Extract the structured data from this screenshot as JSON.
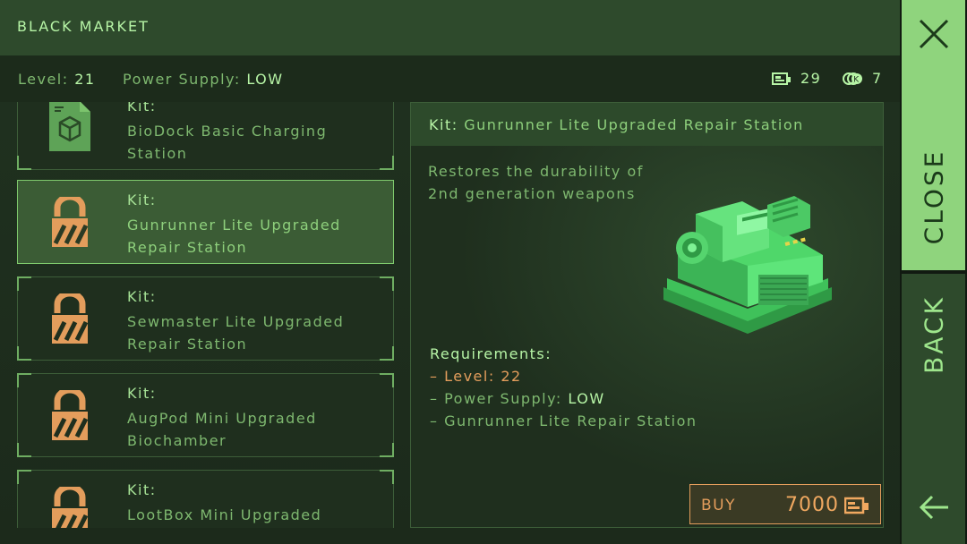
{
  "header": {
    "title": "BLACK MARKET"
  },
  "status": {
    "level_label": "Level:",
    "level_value": "21",
    "power_label": "Power Supply:",
    "power_value": "LOW",
    "caps": "29",
    "tokens": "7"
  },
  "list": {
    "items": [
      {
        "kit_label": "Kit:",
        "name": "BioDock Basic Charging Station",
        "icon": "kit-schematic-icon",
        "locked": false
      },
      {
        "kit_label": "Kit:",
        "name": "Gunrunner Lite Upgraded Repair Station",
        "icon": "lock-icon",
        "locked": true,
        "selected": true
      },
      {
        "kit_label": "Kit:",
        "name": "Sewmaster Lite Upgraded Repair Station",
        "icon": "lock-icon",
        "locked": true
      },
      {
        "kit_label": "Kit:",
        "name": "AugPod Mini Upgraded Biochamber",
        "icon": "lock-icon",
        "locked": true
      },
      {
        "kit_label": "Kit:",
        "name": "LootBox Mini Upgraded",
        "icon": "lock-icon",
        "locked": true
      }
    ]
  },
  "detail": {
    "kit_label": "Kit:",
    "title": "Gunrunner Lite Upgraded Repair Station",
    "description": "Restores the durability of 2nd generation weapons",
    "requirements_heading": "Requirements:",
    "req_level_label": "– Level:",
    "req_level_value": "22",
    "req_power_label": "– Power Supply:",
    "req_power_value": "LOW",
    "req_item": "– Gunrunner Lite Repair Station"
  },
  "buy": {
    "label": "BUY",
    "price": "7000"
  },
  "side": {
    "close_label": "CLOSE",
    "back_label": "BACK"
  },
  "colors": {
    "accent": "#8fd47d",
    "warning": "#e39d5c",
    "text": "#7eb86f"
  }
}
